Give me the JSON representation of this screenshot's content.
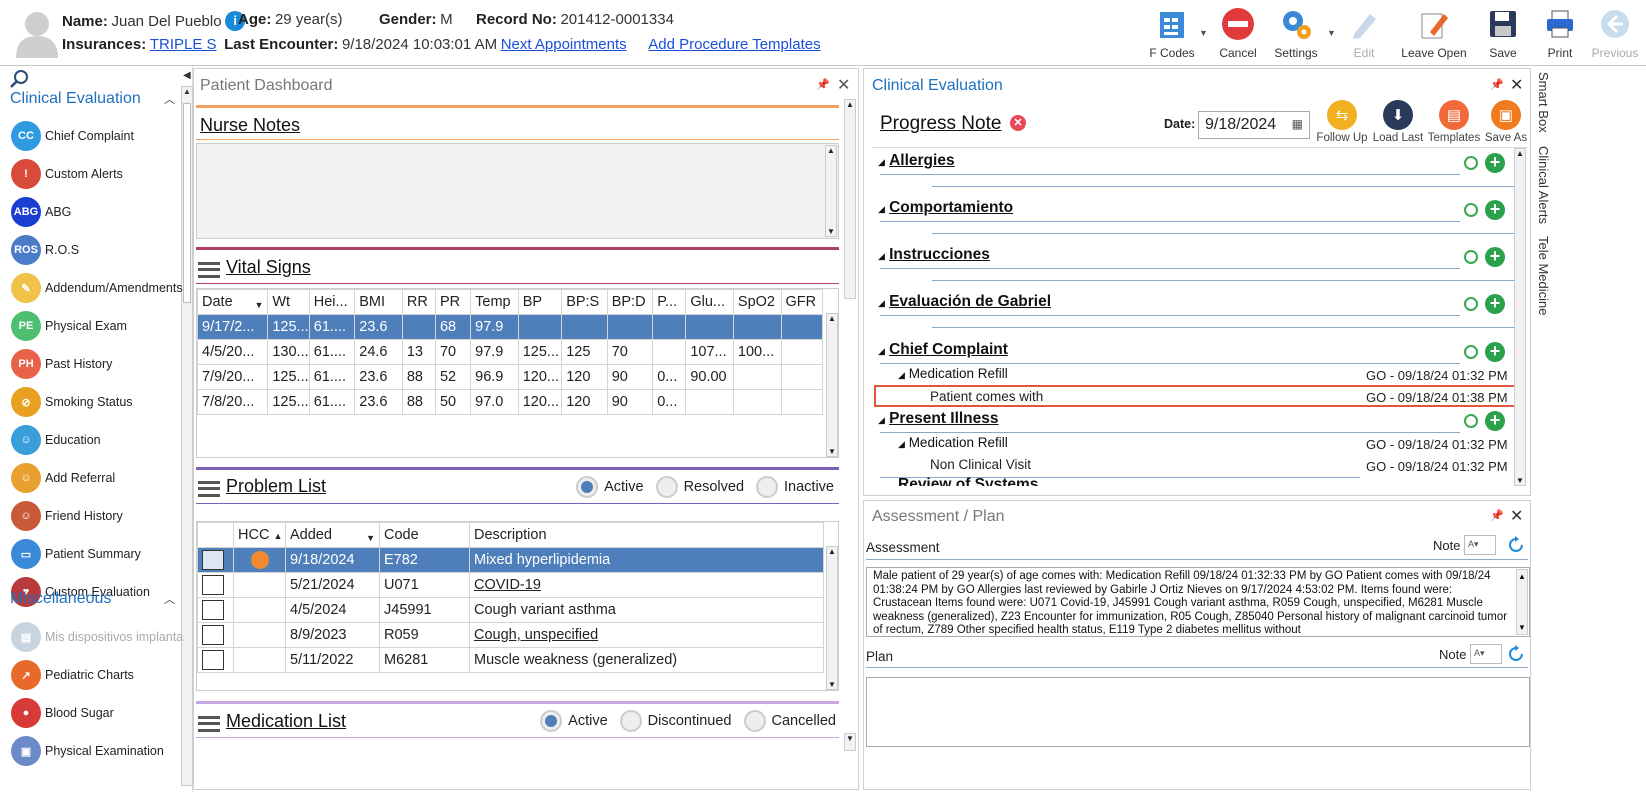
{
  "header": {
    "name_label": "Name:",
    "name": "Juan Del Pueblo",
    "age_label": "Age:",
    "age": "29 year(s)",
    "gender_label": "Gender:",
    "gender": "M",
    "record_label": "Record No:",
    "record": "201412-0001334",
    "insurances_label": "Insurances:",
    "insurance": "TRIPLE S",
    "last_encounter_label": "Last Encounter:",
    "last_encounter": "9/18/2024 10:03:01 AM",
    "next_appointments": "Next Appointments",
    "add_procedure_templates": "Add Procedure Templates"
  },
  "toolbar": {
    "fcodes": "F Codes",
    "cancel": "Cancel",
    "settings": "Settings",
    "edit": "Edit",
    "leave_open": "Leave Open",
    "save": "Save",
    "print": "Print",
    "previous": "Previous"
  },
  "nav": {
    "section1": "Clinical Evaluation",
    "items1": [
      {
        "label": "Chief Complaint",
        "abbr": "CC",
        "color": "#2e9be0"
      },
      {
        "label": "Custom Alerts",
        "abbr": "!",
        "color": "#d84a3a"
      },
      {
        "label": "ABG",
        "abbr": "ABG",
        "color": "#1a3fd0"
      },
      {
        "label": "R.O.S",
        "abbr": "ROS",
        "color": "#4a7cc8"
      },
      {
        "label": "Addendum/Amendments",
        "abbr": "✎",
        "color": "#f0c24a"
      },
      {
        "label": "Physical Exam",
        "abbr": "PE",
        "color": "#4cc070"
      },
      {
        "label": "Past History",
        "abbr": "PH",
        "color": "#e8624a"
      },
      {
        "label": "Smoking Status",
        "abbr": "⊘",
        "color": "#e8a020"
      },
      {
        "label": "Education",
        "abbr": "☺",
        "color": "#3a9ed8"
      },
      {
        "label": "Add Referral",
        "abbr": "☺",
        "color": "#e8a030"
      },
      {
        "label": "Friend History",
        "abbr": "☺",
        "color": "#c85a3a"
      },
      {
        "label": "Patient Summary",
        "abbr": "▭",
        "color": "#3a8ad8"
      },
      {
        "label": "Custom Evaluation",
        "abbr": "♥",
        "color": "#b83a3a"
      }
    ],
    "section2": "Miscellaneous",
    "items2": [
      {
        "label": "Mis dispositivos implanta",
        "abbr": "▤",
        "color": "#c8d4e0"
      },
      {
        "label": "Pediatric Charts",
        "abbr": "↗",
        "color": "#e86a2a"
      },
      {
        "label": "Blood Sugar",
        "abbr": "●",
        "color": "#d83a3a"
      },
      {
        "label": "Physical Examination",
        "abbr": "▣",
        "color": "#6a8ac8"
      }
    ]
  },
  "dashboard": {
    "title": "Patient Dashboard",
    "nurse_notes": "Nurse Notes",
    "vital_signs": "Vital Signs",
    "vitals_headers": [
      "Date",
      "Wt",
      "Hei...",
      "BMI",
      "RR",
      "PR",
      "Temp",
      "BP",
      "BP:S",
      "BP:D",
      "P...",
      "Glu...",
      "SpO2",
      "GFR"
    ],
    "vitals_rows": [
      [
        "9/17/2...",
        "125...",
        "61....",
        "23.6",
        "",
        "68",
        "97.9",
        "",
        "",
        "",
        "",
        "",
        "",
        ""
      ],
      [
        "4/5/20...",
        "130...",
        "61....",
        "24.6",
        "13",
        "70",
        "97.9",
        "125...",
        "125",
        "70",
        "",
        "107...",
        "100...",
        ""
      ],
      [
        "7/9/20...",
        "125...",
        "61....",
        "23.6",
        "88",
        "52",
        "96.9",
        "120...",
        "120",
        "90",
        "0...",
        "90.00",
        "",
        ""
      ],
      [
        "7/8/20...",
        "125...",
        "61....",
        "23.6",
        "88",
        "50",
        "97.0",
        "120...",
        "120",
        "90",
        "0...",
        "",
        "",
        ""
      ]
    ],
    "problem_list": "Problem List",
    "problem_filters": [
      "Active",
      "Resolved",
      "Inactive"
    ],
    "problem_headers": [
      "",
      "HCC",
      "Added",
      "Code",
      "Description"
    ],
    "problem_rows": [
      {
        "hcc": true,
        "added": "9/18/2024",
        "code": "E782",
        "desc": "Mixed hyperlipidemia",
        "link": false
      },
      {
        "hcc": false,
        "added": "5/21/2024",
        "code": "U071",
        "desc": "COVID-19",
        "link": true
      },
      {
        "hcc": false,
        "added": "4/5/2024",
        "code": "J45991",
        "desc": "Cough variant asthma",
        "link": false
      },
      {
        "hcc": false,
        "added": "8/9/2023",
        "code": "R059",
        "desc": "Cough, unspecified",
        "link": true
      },
      {
        "hcc": false,
        "added": "5/11/2022",
        "code": "M6281",
        "desc": "Muscle weakness (generalized)",
        "link": false
      }
    ],
    "medication_list": "Medication List",
    "medication_filters": [
      "Active",
      "Discontinued",
      "Cancelled"
    ]
  },
  "clinical": {
    "title": "Clinical Evaluation",
    "note_title": "Progress Note",
    "date_label": "Date:",
    "date": "9/18/2024",
    "buttons": [
      "Follow Up",
      "Load Last",
      "Templates",
      "Save As"
    ],
    "sections": [
      "Allergies",
      "Comportamiento",
      "Instrucciones",
      "Evaluación de Gabriel"
    ],
    "chief_complaint": "Chief Complaint",
    "cc_sub": "Medication Refill",
    "cc_sub_ts": "GO - 09/18/24 01:32 PM",
    "cc_item": "Patient comes with",
    "cc_item_ts": "GO - 09/18/24 01:38 PM",
    "present_illness": "Present Illness",
    "pi_sub": "Medication Refill",
    "pi_sub_ts": "GO - 09/18/24 01:32 PM",
    "pi_item": "Non Clinical Visit",
    "pi_item_ts": "GO - 09/18/24 01:32 PM",
    "cut_section": "Review of Systems"
  },
  "assessment": {
    "title": "Assessment / Plan",
    "assessment_label": "Assessment",
    "note_label": "Note",
    "text": "Male patient of 29 year(s) of age comes with:   Medication Refill   09/18/24 01:32:33 PM by GO  Patient comes with 09/18/24 01:38:24 PM by GO      Allergies last reviewed by Gabirle J Ortiz Nieves on 9/17/2024 4:53:02 PM.    Items found were:  Crustacean  Items found were:  U071 Covid-19, J45991 Cough variant asthma, R059 Cough, unspecified, M6281 Muscle weakness (generalized), Z23 Encounter for immunization, R05 Cough, Z85040 Personal history of malignant carcinoid tumor of rectum, Z789 Other specified health status, E119 Type 2 diabetes mellitus without",
    "plan_label": "Plan"
  },
  "side_tabs": [
    "Smart Box",
    "Clinical Alerts",
    "Tele Medicine"
  ]
}
